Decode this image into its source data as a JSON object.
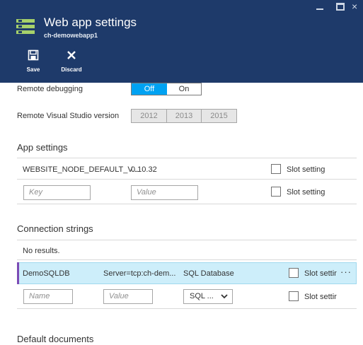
{
  "header": {
    "title": "Web app settings",
    "subtitle": "ch-demowebapp1",
    "window_controls": {
      "close": "×"
    },
    "toolbar": {
      "save_label": "Save",
      "discard_label": "Discard",
      "save_icon": "floppy-icon",
      "discard_icon": "close-icon"
    }
  },
  "debug": {
    "remote_debugging_label": "Remote debugging",
    "toggle": [
      "Off",
      "On"
    ],
    "selected": "Off",
    "vs_version_label": "Remote Visual Studio version",
    "vs_versions": [
      "2012",
      "2013",
      "2015"
    ]
  },
  "app_settings": {
    "title": "App settings",
    "rows": [
      {
        "key": "WEBSITE_NODE_DEFAULT_V...",
        "value": "0.10.32",
        "slot_label": "Slot setting"
      }
    ],
    "new_row": {
      "key_placeholder": "Key",
      "value_placeholder": "Value",
      "slot_label": "Slot setting"
    }
  },
  "connection_strings": {
    "title": "Connection strings",
    "empty_text": "No results.",
    "rows": [
      {
        "name": "DemoSQLDB",
        "value": "Server=tcp:ch-dem...",
        "type": "SQL Database",
        "slot_label": "Slot settir",
        "more": "···"
      }
    ],
    "new_row": {
      "name_placeholder": "Name",
      "value_placeholder": "Value",
      "type_selected": "SQL ...",
      "slot_label": "Slot settir"
    }
  },
  "default_documents": {
    "title": "Default documents"
  },
  "colors": {
    "header_bg": "#1e3a6a",
    "toggle_on": "#00a2f2",
    "row_selected": "#cdeefa",
    "row_accent": "#7b4bb5",
    "icon_green": "#a6d16a"
  }
}
